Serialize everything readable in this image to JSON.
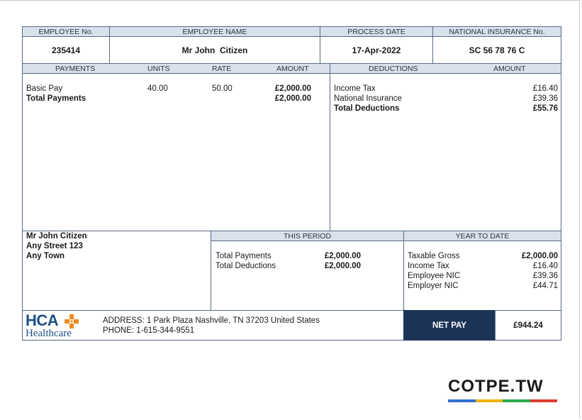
{
  "header": {
    "employee_no_label": "EMPLOYEE No.",
    "employee_name_label": "EMPLOYEE NAME",
    "process_date_label": "PROCESS DATE",
    "ni_label": "NATIONAL INSURANCE No.",
    "employee_no": "235414",
    "employee_name": "Mr John  Citizen",
    "process_date": "17-Apr-2022",
    "ni_number": "SC 56 78 76 C"
  },
  "payments": {
    "col_payments": "PAYMENTS",
    "col_units": "UNITS",
    "col_rate": "RATE",
    "col_amount": "AMOUNT",
    "rows": [
      {
        "name": "Basic Pay",
        "units": "40.00",
        "rate": "50.00",
        "amount": "£2,000.00"
      }
    ],
    "total_label": "Total Payments",
    "total_amount": "£2,000.00"
  },
  "deductions": {
    "col_deductions": "DEDUCTIONS",
    "col_amount": "AMOUNT",
    "rows": [
      {
        "name": "Income Tax",
        "amount": "£16.40"
      },
      {
        "name": "National Insurance",
        "amount": "£39.36"
      }
    ],
    "total_label": "Total Deductions",
    "total_amount": "£55.76"
  },
  "address_block": {
    "name": "Mr John Citizen",
    "street": "Any Street 123",
    "town": "Any Town"
  },
  "this_period": {
    "title": "THIS PERIOD",
    "rows": [
      {
        "label": "Total Payments",
        "value": "£2,000.00"
      },
      {
        "label": "Total Deductions",
        "value": "£2,000.00"
      }
    ]
  },
  "year_to_date": {
    "title": "YEAR TO DATE",
    "rows": [
      {
        "label": "Taxable Gross",
        "value": "£2,000.00"
      },
      {
        "label": "Income Tax",
        "value": "£16.40"
      },
      {
        "label": "Employee NIC",
        "value": "£39.36"
      },
      {
        "label": "Employer NIC",
        "value": "£44.71"
      }
    ]
  },
  "company": {
    "logo_text": "HCA",
    "logo_sub": "Healthcare",
    "address": "ADDRESS: 1 Park Plaza Nashville, TN 37203 United States",
    "phone": "PHONE: 1-615-344-9551"
  },
  "net_pay": {
    "label": "NET PAY",
    "value": "£944.24"
  },
  "watermark": {
    "text": "COTPE.TW",
    "colors": [
      "#2f6fd0",
      "#f2b200",
      "#2aa84a",
      "#e03a2f"
    ]
  },
  "colors": {
    "header_bg": "#d9e1ec",
    "border": "#5a6a80",
    "netpay_bg": "#1c3557",
    "logo_blue": "#1c4f86",
    "logo_orange": "#f08a1c"
  }
}
